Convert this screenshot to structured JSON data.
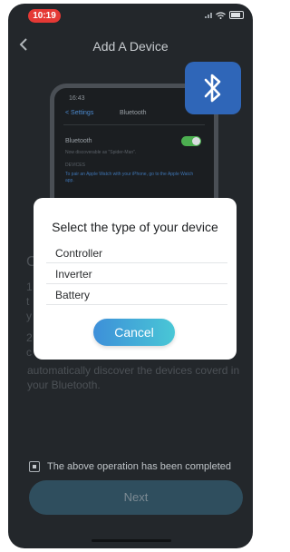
{
  "status_bar": {
    "time": "10:19"
  },
  "nav": {
    "back_icon": "chevron-left-icon",
    "title": "Add A Device"
  },
  "illustration": {
    "time": "16:43",
    "settings_link": "< Settings",
    "screen_title": "Bluetooth",
    "bluetooth_row": "Bluetooth",
    "discoverable": "Now discoverable as \"Spider-Man\".",
    "devices_header": "DEVICES",
    "pair_hint": "To pair an Apple Watch with your iPhone, go to the Apple Watch app.",
    "badge_icon": "bluetooth-icon"
  },
  "background_text": {
    "heading_frag": "C",
    "frag1": "1",
    "frag2": "t",
    "frag3": "y",
    "frag4": "2",
    "frag5": "c",
    "tail": "automatically discover the devices coverd in your Bluetooth."
  },
  "dialog": {
    "title": "Select the type of your device",
    "options": [
      "Controller",
      "Inverter",
      "Battery"
    ],
    "cancel_label": "Cancel"
  },
  "confirm": {
    "label": "The above operation has been completed"
  },
  "next_button": {
    "label": "Next"
  },
  "colors": {
    "accent_start": "#3d8fd9",
    "accent_end": "#49c7d6",
    "status_pill": "#e53935",
    "badge": "#2f66b8"
  }
}
